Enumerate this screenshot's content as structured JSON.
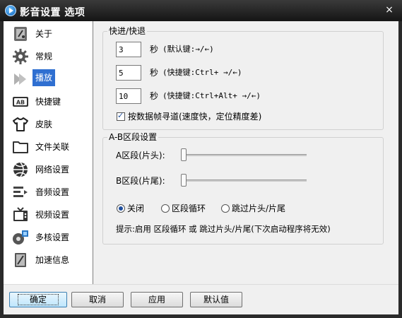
{
  "window": {
    "title": "影音设置 选项",
    "close_glyph": "×"
  },
  "sidebar": {
    "items": [
      {
        "label": "关于",
        "icon": "about-icon"
      },
      {
        "label": "常规",
        "icon": "gear-icon"
      },
      {
        "label": "播放",
        "icon": "play-icon",
        "selected": true
      },
      {
        "label": "快捷键",
        "icon": "keyboard-icon"
      },
      {
        "label": "皮肤",
        "icon": "tshirt-icon"
      },
      {
        "label": "文件关联",
        "icon": "folder-icon"
      },
      {
        "label": "网络设置",
        "icon": "network-icon"
      },
      {
        "label": "音频设置",
        "icon": "audio-icon"
      },
      {
        "label": "视频设置",
        "icon": "tv-icon"
      },
      {
        "label": "多核设置",
        "icon": "multicore-icon"
      },
      {
        "label": "加速信息",
        "icon": "accelerate-icon"
      }
    ]
  },
  "seek": {
    "title": "快进/快退",
    "rows": [
      {
        "value": "3",
        "unit": "秒",
        "hint": "(默认键:→/←)"
      },
      {
        "value": "5",
        "unit": "秒",
        "hint": "(快捷键:Ctrl+ →/←)"
      },
      {
        "value": "10",
        "unit": "秒",
        "hint": "(快捷键:Ctrl+Alt+ →/←)"
      }
    ],
    "keyframe_checkbox": {
      "label": "按数据帧寻道(速度快，定位精度差)",
      "checked": true
    }
  },
  "ab": {
    "title": "A-B区段设置",
    "a_label": "A区段(片头):",
    "a_value": 0,
    "b_label": "B区段(片尾):",
    "b_value": 0,
    "options": [
      {
        "label": "关闭",
        "checked": true
      },
      {
        "label": "区段循环",
        "checked": false
      },
      {
        "label": "跳过片头/片尾",
        "checked": false
      }
    ],
    "hint": "提示:启用 区段循环 或 跳过片头/片尾(下次启动程序将无效)"
  },
  "buttons": {
    "ok": "确定",
    "cancel": "取消",
    "apply": "应用",
    "default": "默认值"
  }
}
